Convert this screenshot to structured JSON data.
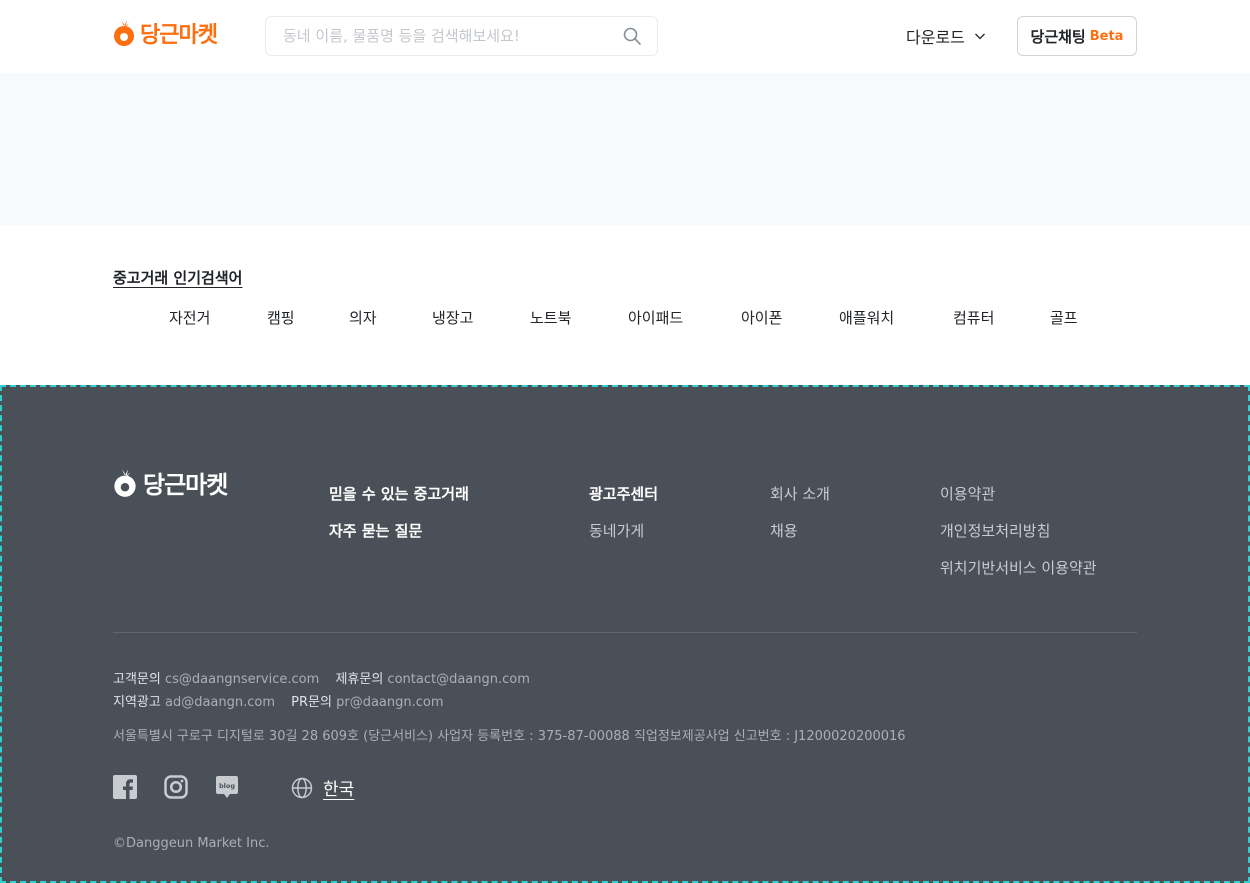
{
  "header": {
    "brand": "당근마켓",
    "search_placeholder": "동네 이름, 물품명 등을 검색해보세요!",
    "download_label": "다운로드",
    "chat_label": "당근채팅",
    "chat_badge": "Beta"
  },
  "popular": {
    "title": "중고거래 인기검색어",
    "keywords": [
      "자전거",
      "캠핑",
      "의자",
      "냉장고",
      "노트북",
      "아이패드",
      "아이폰",
      "애플워치",
      "컴퓨터",
      "골프"
    ]
  },
  "footer": {
    "brand": "당근마켓",
    "links": {
      "col1": [
        "믿을 수 있는 중고거래",
        "자주 묻는 질문"
      ],
      "col2": [
        "광고주센터",
        "동네가게"
      ],
      "col3": [
        "회사 소개",
        "채용"
      ],
      "col4": [
        "이용약관",
        "개인정보처리방침",
        "위치기반서비스 이용약관"
      ]
    },
    "contacts": [
      {
        "label": "고객문의",
        "email": "cs@daangnservice.com"
      },
      {
        "label": "제휴문의",
        "email": "contact@daangn.com"
      },
      {
        "label": "지역광고",
        "email": "ad@daangn.com"
      },
      {
        "label": "PR문의",
        "email": "pr@daangn.com"
      }
    ],
    "address": "서울특별시 구로구 디지털로 30길 28 609호 (당근서비스)   사업자 등록번호 : 375-87-00088   직업정보제공사업 신고번호 : J1200020200016",
    "language": "한국",
    "copyright": "©Danggeun Market Inc."
  },
  "colors": {
    "brand": "#ff6f0f",
    "footer_bg": "#495057"
  },
  "icons": [
    "carrot-logo-icon",
    "search-icon",
    "chevron-down-icon",
    "facebook-icon",
    "instagram-icon",
    "blog-icon",
    "globe-icon"
  ]
}
